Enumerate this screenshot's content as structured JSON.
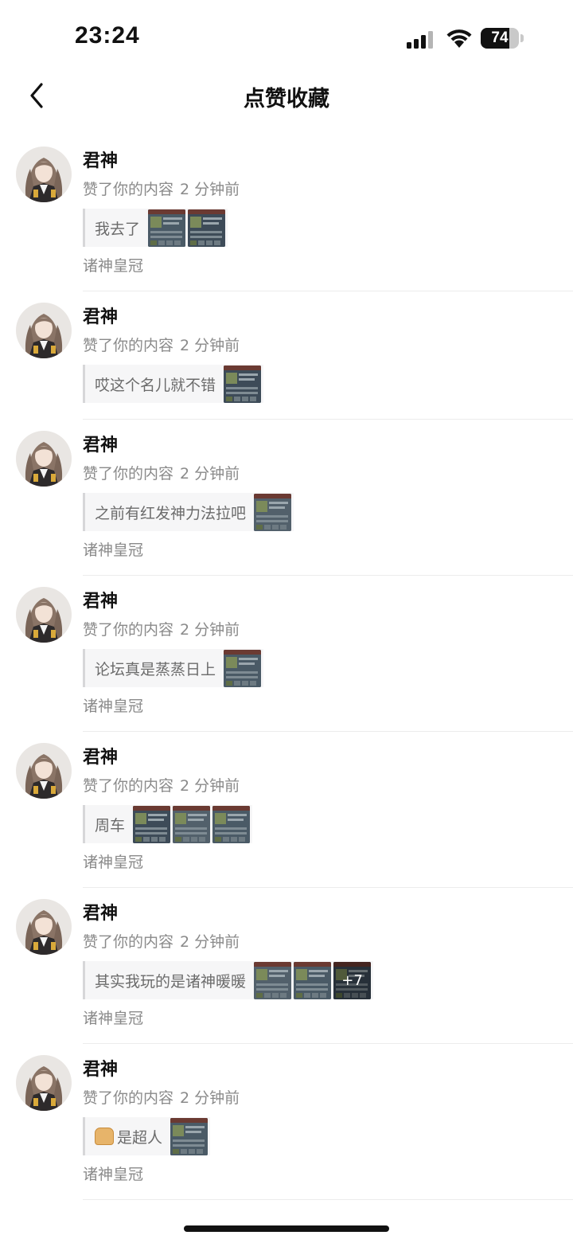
{
  "status_bar": {
    "time": "23:24",
    "battery_level": "74",
    "battery_fraction": 0.74
  },
  "nav": {
    "title": "点赞收藏"
  },
  "items": [
    {
      "user": "君神",
      "action": "赞了你的内容",
      "time": "2 分钟前",
      "quote": "我去了",
      "quote_icon": "",
      "thumbs": 2,
      "more": "",
      "group": "诸神皇冠"
    },
    {
      "user": "君神",
      "action": "赞了你的内容",
      "time": "2 分钟前",
      "quote": "哎这个名儿就不错",
      "quote_icon": "",
      "thumbs": 1,
      "more": "",
      "group": ""
    },
    {
      "user": "君神",
      "action": "赞了你的内容",
      "time": "2 分钟前",
      "quote": "之前有红发神力法拉吧",
      "quote_icon": "",
      "thumbs": 1,
      "more": "",
      "group": "诸神皇冠"
    },
    {
      "user": "君神",
      "action": "赞了你的内容",
      "time": "2 分钟前",
      "quote": "论坛真是蒸蒸日上",
      "quote_icon": "",
      "thumbs": 1,
      "more": "",
      "group": "诸神皇冠"
    },
    {
      "user": "君神",
      "action": "赞了你的内容",
      "time": "2 分钟前",
      "quote": "周车",
      "quote_icon": "",
      "thumbs": 3,
      "more": "",
      "group": "诸神皇冠"
    },
    {
      "user": "君神",
      "action": "赞了你的内容",
      "time": "2 分钟前",
      "quote": "其实我玩的是诸神暖暖",
      "quote_icon": "",
      "thumbs": 3,
      "more": "+7",
      "group": "诸神皇冠"
    },
    {
      "user": "君神",
      "action": "赞了你的内容",
      "time": "2 分钟前",
      "quote": "是超人",
      "quote_icon": "bread-emoji",
      "thumbs": 1,
      "more": "",
      "group": "诸神皇冠"
    }
  ]
}
